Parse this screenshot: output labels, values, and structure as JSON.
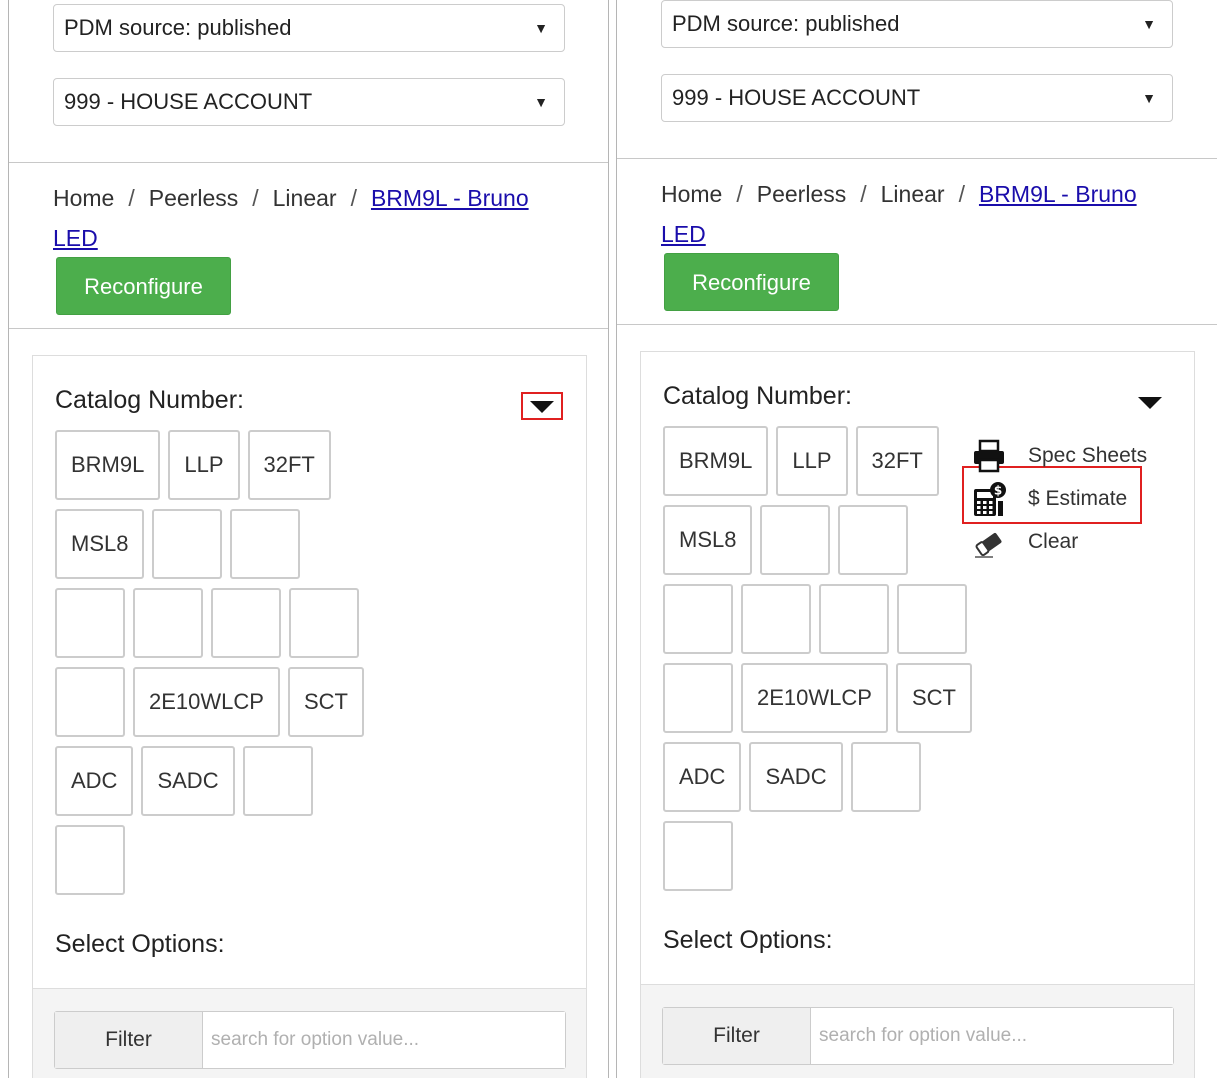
{
  "panels": [
    {
      "id": "left",
      "pdm_select": "PDM source: published",
      "account_select": "999 - HOUSE ACCOUNT",
      "breadcrumb": [
        "Home",
        "Peerless",
        "Linear"
      ],
      "breadcrumb_link": "BRM9L - Bruno LED",
      "reconfigure": "Reconfigure",
      "catalog_label": "Catalog Number:",
      "select_options_label": "Select Options:",
      "filter_label": "Filter",
      "filter_placeholder": "search for option value...",
      "tiles": [
        [
          "BRM9L",
          "LLP",
          "32FT"
        ],
        [
          "MSL8",
          "",
          ""
        ],
        [
          "",
          "",
          "",
          ""
        ],
        [
          "",
          "2E10WLCP",
          "SCT"
        ],
        [
          "ADC",
          "SADC",
          ""
        ],
        [
          ""
        ]
      ]
    },
    {
      "id": "right",
      "pdm_select": "PDM source: published",
      "account_select": "999 - HOUSE ACCOUNT",
      "breadcrumb": [
        "Home",
        "Peerless",
        "Linear"
      ],
      "breadcrumb_link": "BRM9L - Bruno LED",
      "reconfigure": "Reconfigure",
      "catalog_label": "Catalog Number:",
      "select_options_label": "Select Options:",
      "filter_label": "Filter",
      "filter_placeholder": "search for option value...",
      "tiles": [
        [
          "BRM9L",
          "LLP",
          "32FT"
        ],
        [
          "MSL8",
          "",
          ""
        ],
        [
          "",
          "",
          "",
          ""
        ],
        [
          "",
          "2E10WLCP",
          "SCT"
        ],
        [
          "ADC",
          "SADC",
          ""
        ],
        [
          ""
        ]
      ],
      "menu": {
        "spec_sheets": "Spec Sheets",
        "estimate": "$ Estimate",
        "clear": "Clear"
      }
    }
  ],
  "icons": {
    "dropdown_caret": "caret-down-icon",
    "spec_sheets": "printer-icon",
    "estimate": "calculator-icon",
    "clear": "eraser-icon"
  },
  "colors": {
    "primary_button": "#4cae4c",
    "highlight": "#e02020",
    "link": "#1a0dab"
  }
}
